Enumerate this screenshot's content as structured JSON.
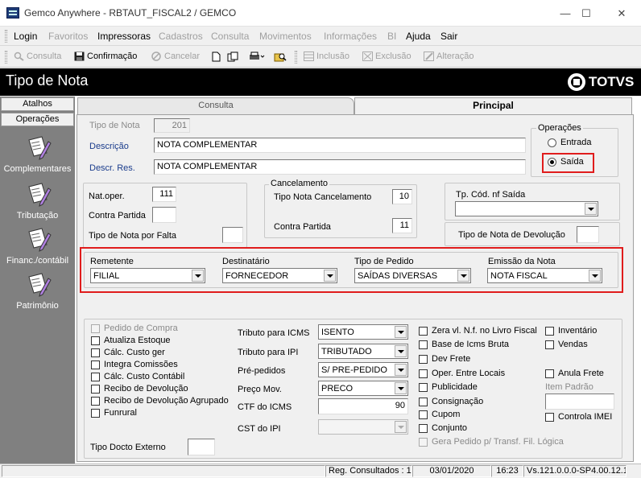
{
  "window": {
    "title": "Gemco Anywhere - RBTAUT_FISCAL2 / GEMCO",
    "minimize": "—",
    "maximize": "☐",
    "close": "✕"
  },
  "menu": {
    "items": [
      {
        "label": "Login",
        "enabled": true
      },
      {
        "label": "Favoritos",
        "enabled": false
      },
      {
        "label": "Impressoras",
        "enabled": true
      },
      {
        "label": "Cadastros",
        "enabled": false
      },
      {
        "label": "Consulta",
        "enabled": false
      },
      {
        "label": "Movimentos",
        "enabled": false
      },
      {
        "label": "Informações",
        "enabled": false
      },
      {
        "label": "BI",
        "enabled": false
      },
      {
        "label": "Ajuda",
        "enabled": true
      },
      {
        "label": "Sair",
        "enabled": true
      }
    ]
  },
  "toolbar": {
    "consulta": "Consulta",
    "confirmacao": "Confirmação",
    "cancelar": "Cancelar",
    "inclusao": "Inclusão",
    "exclusao": "Exclusão",
    "alteracao": "Alteração"
  },
  "header": {
    "title": "Tipo de Nota",
    "logo": "TOTVS"
  },
  "sidebar": {
    "tabs": [
      "Atalhos",
      "Operações"
    ],
    "items": [
      "Complementares",
      "Tributação",
      "Financ./contábil",
      "Patrimônio"
    ]
  },
  "tabs": {
    "consulta": "Consulta",
    "principal": "Principal"
  },
  "form": {
    "tipo_nota_label": "Tipo de Nota",
    "tipo_nota": "201",
    "descricao_label": "Descrição",
    "descricao": "NOTA COMPLEMENTAR",
    "descr_res_label": "Descr. Res.",
    "descr_res": "NOTA COMPLEMENTAR",
    "operacoes_title": "Operações",
    "entrada": "Entrada",
    "saida": "Saída",
    "operacao_selecionada": "Saída",
    "nat_oper_label": "Nat.oper.",
    "nat_oper": "111",
    "contra_partida_label": "Contra Partida",
    "contra_partida": "",
    "tipo_nota_falta_label": "Tipo de Nota por Falta",
    "tipo_nota_falta": "",
    "cancelamento_title": "Cancelamento",
    "tipo_nota_cancel_label": "Tipo Nota Cancelamento",
    "tipo_nota_cancel": "10",
    "cancel_contra_partida_label": "Contra Partida",
    "cancel_contra_partida": "11",
    "tp_cod_nf_saida_label": "Tp. Cód. nf Saída",
    "tp_cod_nf_saida": "",
    "tipo_nota_devolucao_label": "Tipo de Nota de Devolução",
    "tipo_nota_devolucao": "",
    "remetente_label": "Remetente",
    "remetente": "FILIAL",
    "destinatario_label": "Destinatário",
    "destinatario": "FORNECEDOR",
    "tipo_pedido_label": "Tipo de Pedido",
    "tipo_pedido": "SAÍDAS DIVERSAS",
    "emissao_label": "Emissão da Nota",
    "emissao": "NOTA FISCAL",
    "checks_left": [
      {
        "label": "Pedido de Compra",
        "checked": false,
        "enabled": false
      },
      {
        "label": "Atualiza Estoque",
        "checked": false,
        "enabled": true
      },
      {
        "label": "Cálc. Custo ger",
        "checked": false,
        "enabled": true
      },
      {
        "label": "Integra Comissões",
        "checked": false,
        "enabled": true
      },
      {
        "label": "Cálc. Custo Contábil",
        "checked": false,
        "enabled": true
      },
      {
        "label": "Recibo de Devolução",
        "checked": false,
        "enabled": true
      },
      {
        "label": "Recibo de Devolução Agrupado",
        "checked": false,
        "enabled": true
      },
      {
        "label": "Funrural",
        "checked": false,
        "enabled": true
      }
    ],
    "tipo_docto_externo_label": "Tipo Docto Externo",
    "tipo_docto_externo": "",
    "tributo_icms_label": "Tributo para ICMS",
    "tributo_icms": "ISENTO",
    "tributo_ipi_label": "Tributo para IPI",
    "tributo_ipi": "TRIBUTADO",
    "pre_pedidos_label": "Pré-pedidos",
    "pre_pedidos": "S/ PRE-PEDIDO",
    "preco_mov_label": "Preço Mov.",
    "preco_mov": "PRECO",
    "ctf_icms_label": "CTF do ICMS",
    "ctf_icms": "90",
    "cst_ipi_label": "CST do IPI",
    "cst_ipi": "",
    "checks_mid": [
      {
        "label": "Zera vl. N.f. no Livro Fiscal",
        "checked": false,
        "enabled": true
      },
      {
        "label": "Base de Icms Bruta",
        "checked": false,
        "enabled": true
      },
      {
        "label": "Dev Frete",
        "checked": false,
        "enabled": true
      },
      {
        "label": "Oper. Entre Locais",
        "checked": false,
        "enabled": true
      },
      {
        "label": "Publicidade",
        "checked": false,
        "enabled": true
      },
      {
        "label": "Consignação",
        "checked": false,
        "enabled": true
      },
      {
        "label": "Cupom",
        "checked": false,
        "enabled": true
      },
      {
        "label": "Conjunto",
        "checked": false,
        "enabled": true
      },
      {
        "label": "Gera Pedido p/ Transf. Fil. Lógica",
        "checked": false,
        "enabled": false
      }
    ],
    "checks_right": [
      {
        "label": "Inventário",
        "checked": false,
        "enabled": true
      },
      {
        "label": "Vendas",
        "checked": false,
        "enabled": true
      },
      {
        "label": "Anula Frete",
        "checked": false,
        "enabled": true
      }
    ],
    "item_padrao_label": "Item Padrão",
    "item_padrao": "",
    "controla_imei": "Controla IMEI"
  },
  "status": {
    "regs": "Reg. Consultados : 1",
    "date": "03/01/2020",
    "time": "16:23",
    "version": "Vs.121.0.0.0-SP4.00.12.1"
  },
  "colors": {
    "highlight": "#e01c1c",
    "header": "#000000",
    "sidebar": "#808080",
    "label_blue": "#1a3c8c"
  }
}
